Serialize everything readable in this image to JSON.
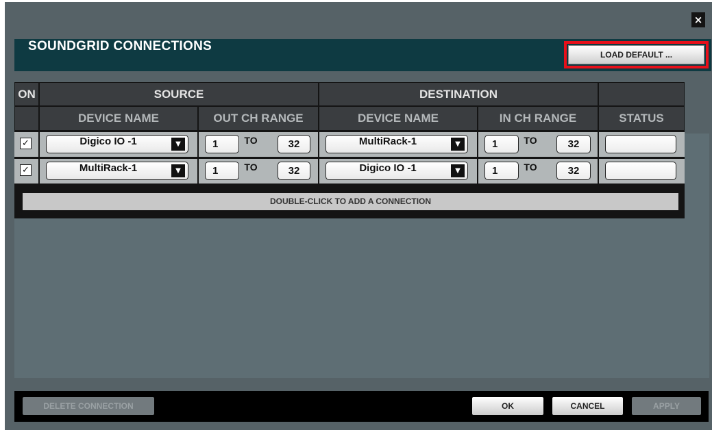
{
  "dialog": {
    "title": "SOUNDGRID CONNECTIONS",
    "close_label": "×",
    "load_default_label": "LOAD DEFAULT ..."
  },
  "table": {
    "headers": {
      "on": "ON",
      "source": "SOURCE",
      "destination": "DESTINATION",
      "src_device": "DEVICE NAME",
      "out_range": "OUT CH RANGE",
      "dst_device": "DEVICE NAME",
      "in_range": "IN CH RANGE",
      "status": "STATUS"
    },
    "rows": [
      {
        "checked": "✓",
        "source_device": "Digico IO -1",
        "out_from": "1",
        "out_to_label": "TO",
        "out_to": "32",
        "dest_device": "MultiRack-1",
        "in_from": "1",
        "in_to_label": "TO",
        "in_to": "32",
        "status": ""
      },
      {
        "checked": "✓",
        "source_device": "MultiRack-1",
        "out_from": "1",
        "out_to_label": "TO",
        "out_to": "32",
        "dest_device": "Digico IO -1",
        "in_from": "1",
        "in_to_label": "TO",
        "in_to": "32",
        "status": ""
      }
    ],
    "add_connection_label": "DOUBLE-CLICK TO ADD A CONNECTION"
  },
  "footer": {
    "delete_label": "DELETE CONNECTION",
    "ok_label": "OK",
    "cancel_label": "CANCEL",
    "apply_label": "APPLY"
  },
  "icons": {
    "dropdown_arrow": "▼",
    "close": "×"
  },
  "colors": {
    "header_bg": "#0e3a42",
    "highlight": "#e8101a",
    "panel_bg": "#566267"
  }
}
